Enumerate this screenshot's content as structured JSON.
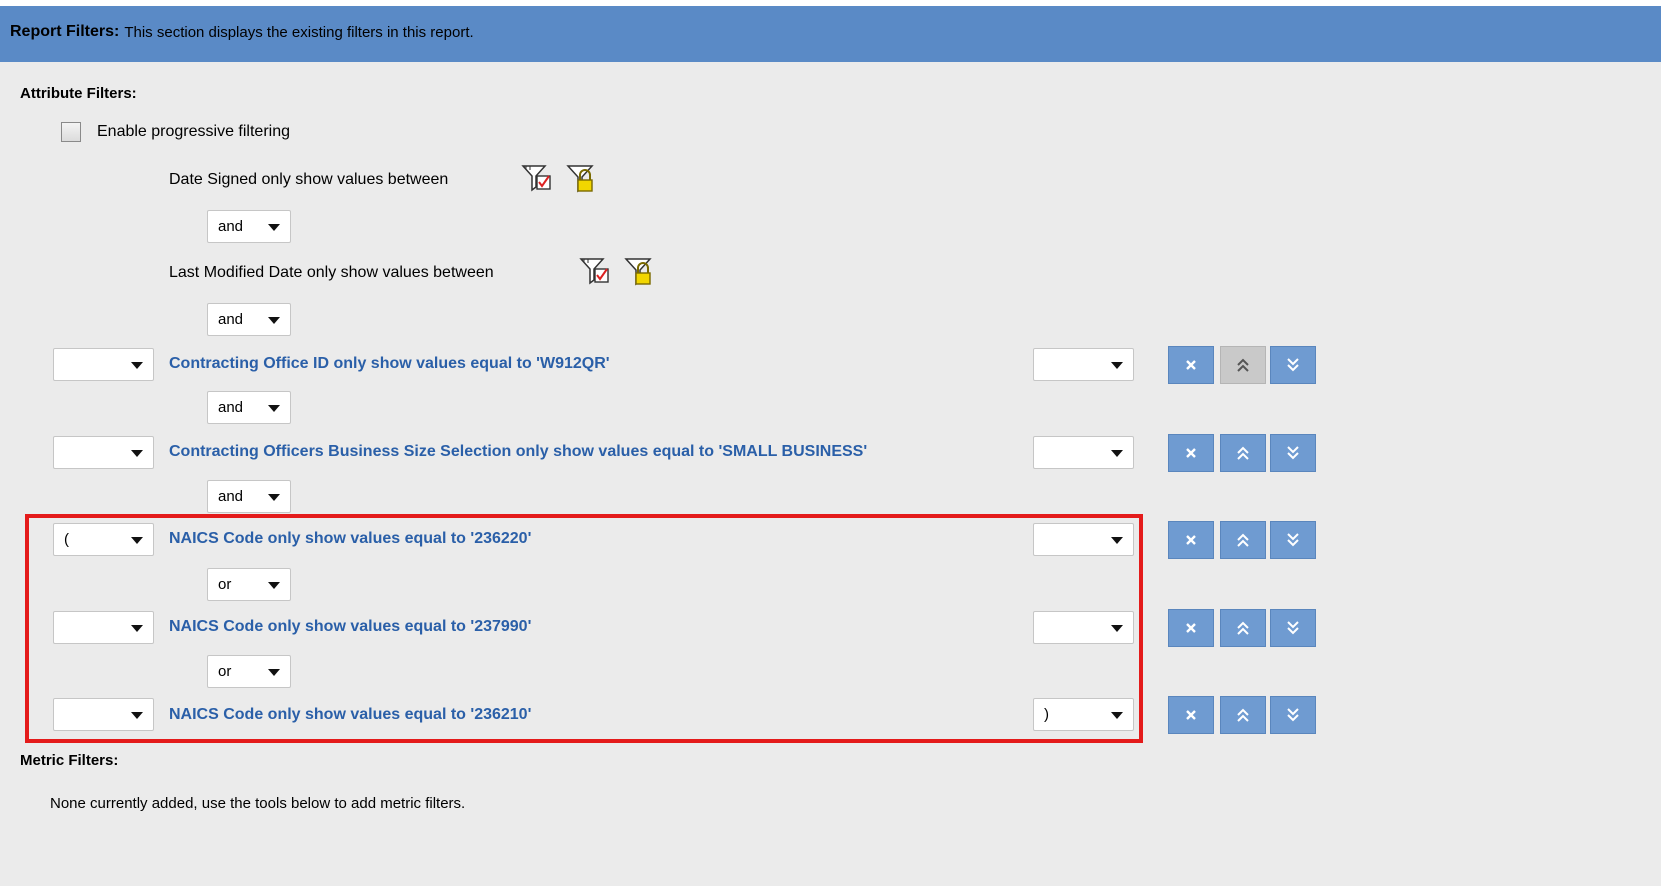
{
  "header": {
    "title": "Report Filters:",
    "description": "This section displays the existing filters in this report."
  },
  "attribute_filters": {
    "title": "Attribute Filters:",
    "progressive_label": "Enable progressive filtering",
    "progressive_checked": false,
    "fixed_filters": [
      {
        "text": "Date Signed only show values between",
        "connector": "and"
      },
      {
        "text": "Last Modified Date only show values between",
        "connector": "and"
      }
    ],
    "filters": [
      {
        "open_paren": "",
        "text": "Contracting Office ID only show values equal to 'W912QR'",
        "close_paren": "",
        "connector": "and",
        "move_up_enabled": false
      },
      {
        "open_paren": "",
        "text": "Contracting Officers Business Size Selection only show values equal to 'SMALL BUSINESS'",
        "close_paren": "",
        "connector": "and",
        "move_up_enabled": true
      },
      {
        "open_paren": "(",
        "text": "NAICS Code only show values equal to '236220'",
        "close_paren": "",
        "connector": "or",
        "move_up_enabled": true
      },
      {
        "open_paren": "",
        "text": "NAICS Code only show values equal to '237990'",
        "close_paren": "",
        "connector": "or",
        "move_up_enabled": true
      },
      {
        "open_paren": "",
        "text": "NAICS Code only show values equal to '236210'",
        "close_paren": ")",
        "connector": "",
        "move_up_enabled": true
      }
    ]
  },
  "metric_filters": {
    "title": "Metric Filters:",
    "empty_text": "None currently added, use the tools below to add metric filters."
  },
  "icons": {
    "edit_filter": "filter-edit-icon",
    "lock_filter": "filter-lock-icon",
    "delete": "close-icon",
    "move_up": "double-chevron-up-icon",
    "move_down": "double-chevron-down-icon"
  },
  "colors": {
    "header_bar": "#5a8ac6",
    "link": "#2a5fa8",
    "button": "#6f9bd1",
    "highlight": "#e41b1b",
    "background": "#ebebeb"
  }
}
